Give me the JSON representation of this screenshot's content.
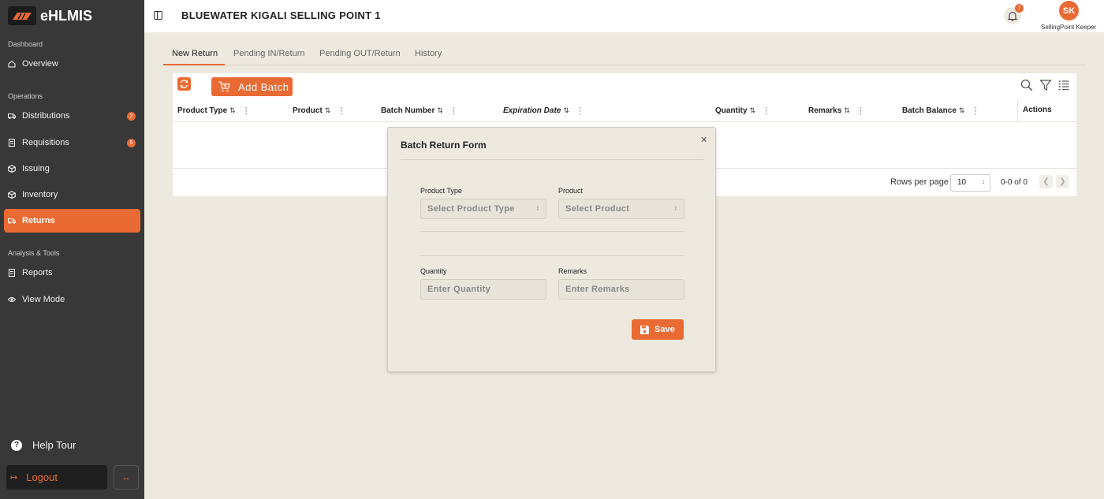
{
  "brand": {
    "name": "eHLMIS"
  },
  "sidebar": {
    "sections": [
      "Dashboard",
      "Operations",
      "Analysis & Tools"
    ],
    "items": [
      {
        "label": "Overview"
      },
      {
        "label": "Distributions",
        "badge": "2"
      },
      {
        "label": "Requisitions",
        "badge": "5"
      },
      {
        "label": "Issuing"
      },
      {
        "label": "Inventory"
      },
      {
        "label": "Returns"
      },
      {
        "label": "Reports"
      },
      {
        "label": "View Mode"
      }
    ],
    "help_label": "Help Tour",
    "logout_label": "Logout"
  },
  "header": {
    "title": "BLUEWATER KIGALI SELLING POINT 1",
    "notification_count": "7",
    "avatar_initials": "SK",
    "role": "SellingPoint Keeper"
  },
  "tabs": [
    "New Return",
    "Pending IN/Return",
    "Pending OUT/Return",
    "History"
  ],
  "toolbar": {
    "add_batch_label": "Add Batch"
  },
  "table": {
    "columns": [
      "Product Type",
      "Product",
      "Batch Number",
      "Expiration Date",
      "Quantity",
      "Remarks",
      "Batch Balance",
      "Actions"
    ],
    "rows_per_page_label": "Rows per page",
    "rows_per_page": "10",
    "range": "0-0 of 0"
  },
  "modal": {
    "title": "Batch Return Form",
    "fields": {
      "product_type": {
        "label": "Product Type",
        "placeholder": "Select Product Type"
      },
      "product": {
        "label": "Product",
        "placeholder": "Select Product"
      },
      "quantity": {
        "label": "Quantity",
        "placeholder": "Enter Quantity"
      },
      "remarks": {
        "label": "Remarks",
        "placeholder": "Enter Remarks"
      }
    },
    "save_label": "Save"
  },
  "colors": {
    "accent": "#ea6a34",
    "sidebar": "#383838",
    "background": "#ede9df"
  }
}
